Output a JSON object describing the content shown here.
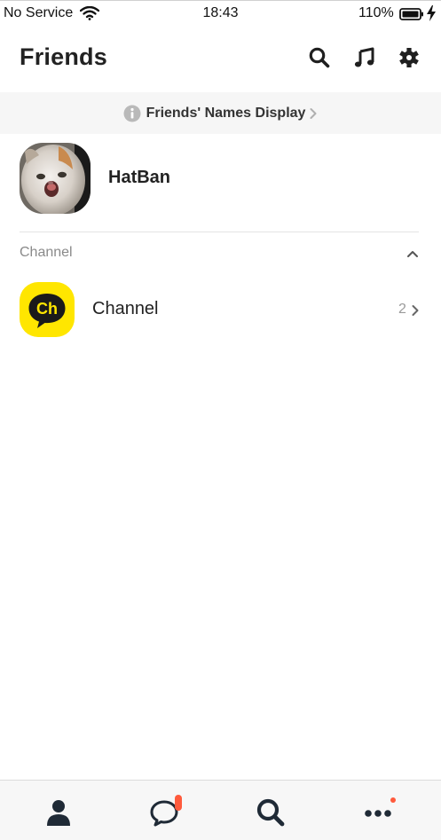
{
  "status_bar": {
    "carrier": "No Service",
    "time": "18:43",
    "battery": "110%"
  },
  "header": {
    "title": "Friends",
    "icons": [
      "search-icon",
      "music-icon",
      "gear-icon"
    ]
  },
  "notice": {
    "label": "Friends' Names Display"
  },
  "my_profile": {
    "name": "HatBan"
  },
  "sections": {
    "channel": {
      "title": "Channel",
      "item_label": "Channel",
      "item_count": "2",
      "icon_text": "Ch",
      "icon_color": "#ffe600"
    }
  },
  "tab_bar": {
    "tabs": [
      "friends-tab",
      "chats-tab",
      "search-tab",
      "more-tab"
    ],
    "badge_color": "#ff5a3c"
  }
}
